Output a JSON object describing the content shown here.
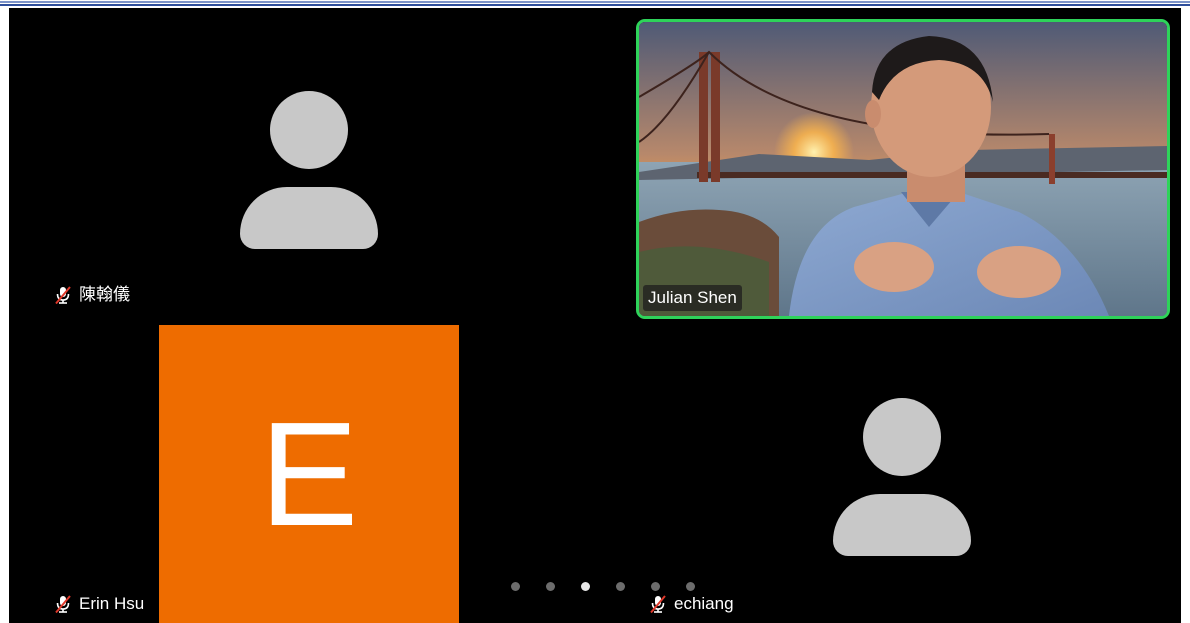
{
  "participants": [
    {
      "name": "陳翰儀",
      "muted": true,
      "type": "avatar"
    },
    {
      "name": "Julian Shen",
      "muted": false,
      "type": "video",
      "speaking": true
    },
    {
      "name": "Erin Hsu",
      "muted": true,
      "type": "initial",
      "initial": "E",
      "tile_color": "#ee6c00"
    },
    {
      "name": "echiang",
      "muted": true,
      "type": "avatar"
    }
  ],
  "pager": {
    "pages": 6,
    "current": 3
  },
  "colors": {
    "speaking_border": "#2ed35a",
    "avatar": "#c8c8c8",
    "background": "#000000"
  }
}
